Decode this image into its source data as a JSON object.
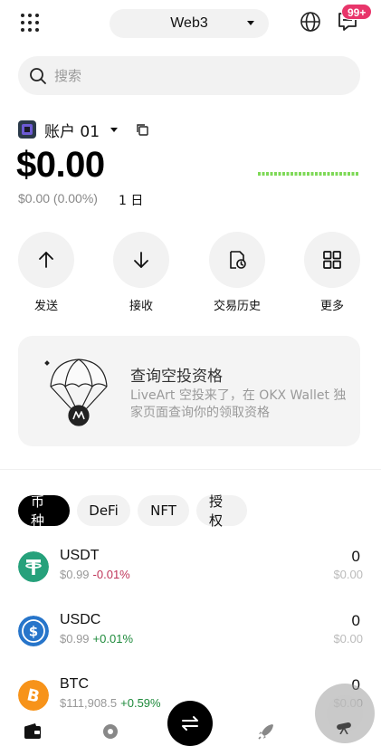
{
  "header": {
    "mode_label": "Web3",
    "notification_badge": "99+"
  },
  "search": {
    "placeholder": "搜索"
  },
  "account": {
    "name": "账户 01",
    "balance": "$0.00",
    "change": "$0.00 (0.00%)",
    "period": "1 日"
  },
  "actions": [
    {
      "label": "发送",
      "icon": "arrow-up-icon"
    },
    {
      "label": "接收",
      "icon": "arrow-down-icon"
    },
    {
      "label": "交易历史",
      "icon": "history-icon"
    },
    {
      "label": "更多",
      "icon": "grid-icon"
    }
  ],
  "promo": {
    "title": "查询空投资格",
    "description": "LiveArt 空投来了，在 OKX Wallet 独家页面查询你的领取资格"
  },
  "tabs": [
    {
      "label": "币种",
      "active": true
    },
    {
      "label": "DeFi",
      "active": false
    },
    {
      "label": "NFT",
      "active": false
    },
    {
      "label": "授权",
      "active": false
    }
  ],
  "assets": [
    {
      "symbol": "USDT",
      "price": "$0.99",
      "change": "-0.01%",
      "change_dir": "neg",
      "amount": "0",
      "value": "$0.00",
      "color": "#26a17b"
    },
    {
      "symbol": "USDC",
      "price": "$0.99",
      "change": "+0.01%",
      "change_dir": "pos",
      "amount": "0",
      "value": "$0.00",
      "color": "#2775ca"
    },
    {
      "symbol": "BTC",
      "price": "$111,908.5",
      "change": "+0.59%",
      "change_dir": "pos",
      "amount": "0",
      "value": "$0.00",
      "color": "#f7931a"
    }
  ],
  "nav": [
    {
      "icon": "wallet-icon"
    },
    {
      "icon": "discover-icon"
    },
    {
      "icon": "swap-icon"
    },
    {
      "icon": "rocket-icon"
    },
    {
      "icon": "telescope-icon"
    }
  ],
  "colors": {
    "sparkline": "#7ed957",
    "negative": "#c0355a",
    "positive": "#1e8a3b",
    "badge": "#e8356a"
  }
}
